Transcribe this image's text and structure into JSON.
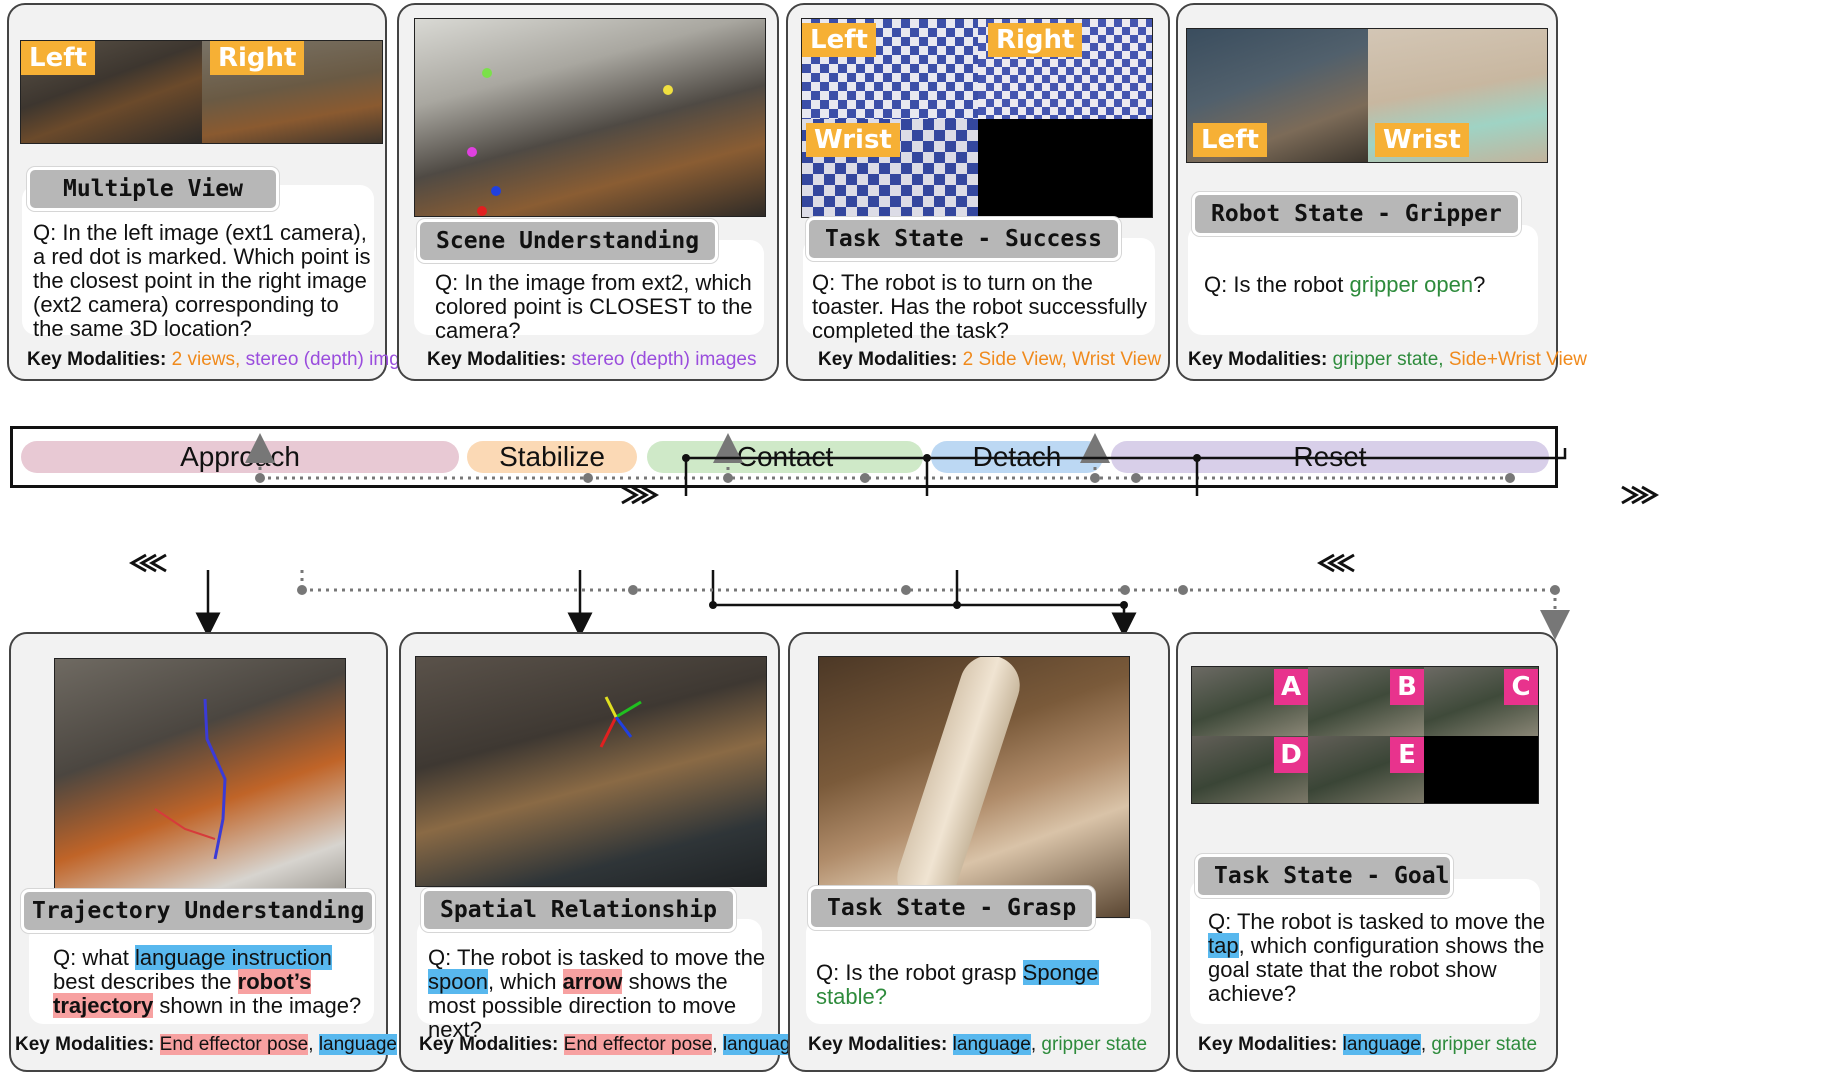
{
  "phases": {
    "approach": "Approach",
    "stabilize": "Stabilize",
    "contact": "Contact",
    "detach": "Detach",
    "reset": "Reset"
  },
  "colors": {
    "approach": "#e8c9d4",
    "stabilize": "#fbd9b5",
    "contact": "#cfe9c8",
    "detach": "#bcd8f3",
    "reset": "#d8cfe9",
    "highlight_blue": "#58b8ee",
    "highlight_red": "#f7a1a1",
    "tag_orange": "#f6b035",
    "letter_pink": "#e8338d"
  },
  "cards": {
    "multiple_view": {
      "label": "Multiple View",
      "tags": [
        "Left",
        "Right"
      ],
      "q": "Q: In the left image (ext1 camera), a red dot is marked. Which point is the closest point in the right image (ext2 camera) corresponding to the same 3D location?",
      "km_prefix": "Key Modalities:",
      "km_1": "2 views,",
      "km_2": "stereo (depth) img"
    },
    "scene_understanding": {
      "label": "Scene Understanding",
      "q": "Q: In the image from ext2, which colored point is CLOSEST to the camera?",
      "km_prefix": "Key Modalities:",
      "km_1": "stereo (depth) images"
    },
    "task_success": {
      "label": "Task State - Success",
      "tags": [
        "Left",
        "Right",
        "Wrist"
      ],
      "q": "Q: The robot is to turn on the toaster. Has the robot successfully completed the task?",
      "km_prefix": "Key Modalities:",
      "km_1": "2 Side View, Wrist View"
    },
    "robot_gripper": {
      "label": "Robot State - Gripper",
      "tags": [
        "Left",
        "Wrist"
      ],
      "q_pre": "Q: Is the robot",
      "q_green": "gripper open",
      "q_post": "?",
      "km_prefix": "Key Modalities:",
      "km_1": "gripper state,",
      "km_2": "Side+Wrist View"
    },
    "trajectory": {
      "label": "Trajectory Understanding",
      "q_1": "Q: what",
      "q_2": "language instruction",
      "q_3": "best describes the",
      "q_4": "robot’s trajectory",
      "q_5": "shown in the image?",
      "km_prefix": "Key Modalities:",
      "km_1": "End effector pose",
      "km_sep": ",",
      "km_2": "language"
    },
    "spatial": {
      "label": "Spatial Relationship",
      "q_1": "Q: The robot is tasked to move the",
      "q_2": "spoon",
      "q_3": ", which",
      "q_4": "arrow",
      "q_5": "shows the most possible direction to move next?",
      "km_prefix": "Key Modalities:",
      "km_1": "End effector pose",
      "km_sep": ",",
      "km_2": "language"
    },
    "grasp": {
      "label": "Task State - Grasp",
      "q_1": "Q: Is the robot grasp",
      "q_2": "Sponge",
      "q_3": "stable?",
      "km_prefix": "Key Modalities:",
      "km_1": "language",
      "km_sep": ",",
      "km_2": "gripper state"
    },
    "goal": {
      "label": "Task State - Goal",
      "letters": [
        "A",
        "B",
        "C",
        "D",
        "E"
      ],
      "q_1": "Q: The robot is tasked to move the",
      "q_2": "tap",
      "q_3": ", which configuration shows the goal state that the robot show achieve?",
      "km_prefix": "Key Modalities:",
      "km_1": "language",
      "km_sep": ",",
      "km_2": "gripper state"
    }
  }
}
